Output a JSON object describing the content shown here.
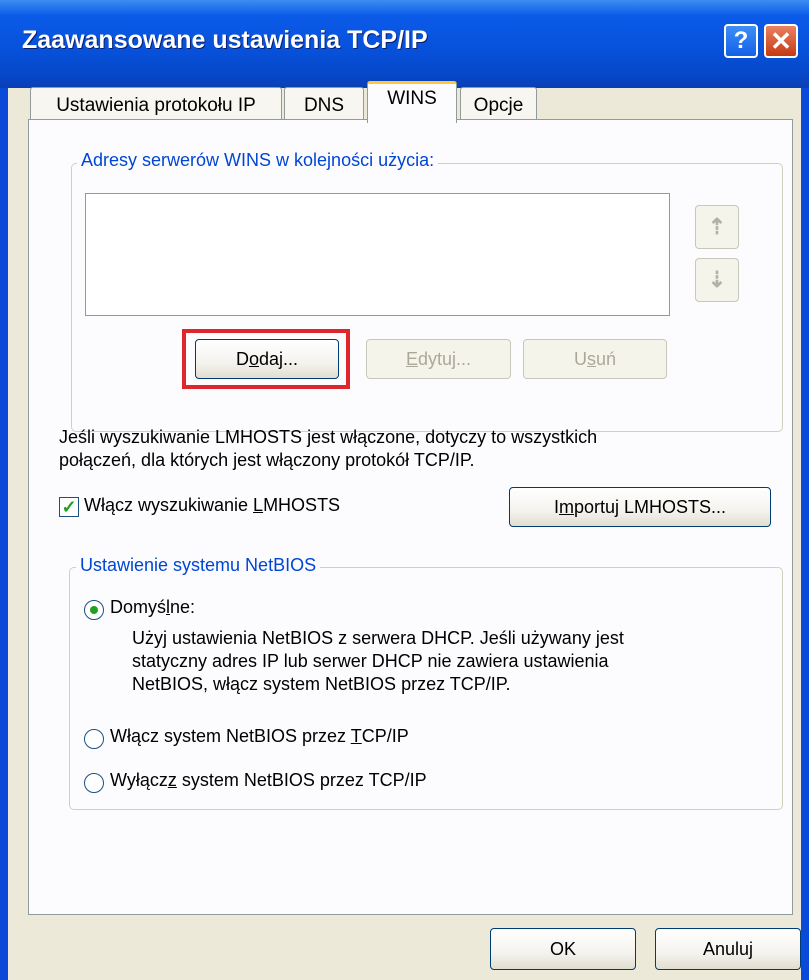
{
  "window": {
    "title": "Zaawansowane ustawienia TCP/IP",
    "help_glyph": "?",
    "close_glyph": "✕"
  },
  "tabs": [
    {
      "label": "Ustawienia protokołu IP",
      "active": false
    },
    {
      "label": "DNS",
      "active": false
    },
    {
      "label": "WINS",
      "active": true
    },
    {
      "label": "Opcje",
      "active": false
    }
  ],
  "wins_group": {
    "label": "Adresy serwerów WINS w kolejności użycia:",
    "items": [],
    "up_icon": "up-arrow-icon",
    "down_icon": "down-arrow-icon"
  },
  "buttons": {
    "add": {
      "pre": "D",
      "accel": "o",
      "post": "daj...",
      "enabled": true
    },
    "edit": {
      "pre": "",
      "accel": "E",
      "post": "dytuj...",
      "enabled": false
    },
    "remove": {
      "pre": "U",
      "accel": "s",
      "post": "uń",
      "enabled": false
    },
    "import": {
      "pre": "I",
      "accel": "m",
      "post": "portuj LMHOSTS...",
      "enabled": true
    },
    "ok": {
      "label": "OK"
    },
    "cancel": {
      "label": "Anuluj"
    }
  },
  "lmhosts": {
    "description_line1": "Jeśli wyszukiwanie LMHOSTS jest włączone, dotyczy to wszystkich",
    "description_line2": "połączeń, dla których jest włączony protokół TCP/IP.",
    "checkbox": {
      "checked": true,
      "pre": "Włącz wyszukiwanie ",
      "accel": "L",
      "post": "MHOSTS"
    }
  },
  "netbios_group": {
    "label": "Ustawienie systemu NetBIOS",
    "options": [
      {
        "pre": "Domyś",
        "accel": "l",
        "post": "ne:",
        "selected": true,
        "desc_line1": "Użyj ustawienia NetBIOS z serwera DHCP. Jeśli używany jest",
        "desc_line2": "statyczny adres IP lub serwer DHCP nie zawiera ustawienia",
        "desc_line3": "NetBIOS, włącz system NetBIOS przez TCP/IP."
      },
      {
        "pre": "Włącz system NetBIOS przez ",
        "accel": "T",
        "post": "CP/IP",
        "selected": false
      },
      {
        "pre": "Wyłącz",
        "accel": "z",
        "post": " system NetBIOS przez TCP/IP",
        "selected": false
      }
    ]
  },
  "colors": {
    "highlight_box": "#e0262d",
    "group_label": "#0046d5",
    "titlebar": "#0752dc"
  }
}
